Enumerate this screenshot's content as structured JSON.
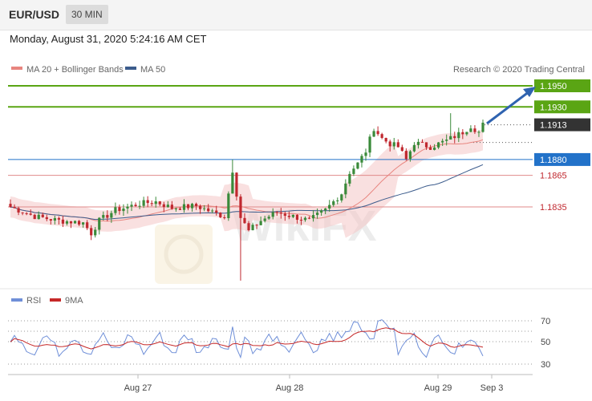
{
  "header": {
    "symbol": "EUR/USD",
    "timeframe": "30 MIN",
    "datetime": "Monday, August 31, 2020 5:24:16 AM CET"
  },
  "legend": {
    "ma20": "MA 20 + Bollinger Bands",
    "ma50": "MA 50",
    "credit": "Research © 2020 Trading Central"
  },
  "levels": [
    {
      "value": "1.1950",
      "color": "#5aa514",
      "style": "solid",
      "label_style": "box"
    },
    {
      "value": "1.1930",
      "color": "#5aa514",
      "style": "solid",
      "label_style": "box"
    },
    {
      "value": "1.1913",
      "color": "#333333",
      "style": "dotted",
      "label_style": "box"
    },
    {
      "value": "1.1880",
      "color": "#2272c9",
      "style": "solid",
      "label_style": "box"
    },
    {
      "value": "1.1865",
      "color": "#e08a8a",
      "style": "solid",
      "label_style": "text"
    },
    {
      "value": "1.1835",
      "color": "#e08a8a",
      "style": "solid",
      "label_style": "text"
    }
  ],
  "rsi_legend": {
    "rsi": "RSI",
    "ma9": "9MA"
  },
  "rsi_levels": [
    "70",
    "50",
    "30"
  ],
  "x_labels": [
    "Aug 27",
    "Aug 28",
    "Aug 29",
    "Sep 3"
  ],
  "watermark": "WikiFX",
  "colors": {
    "up": "#3a8a3a",
    "down": "#c0282f",
    "ma20": "#e8857f",
    "ma50": "#3c5c8c",
    "rsi": "#6f8fd8",
    "rsi_ma": "#c62828",
    "support": "#2272c9",
    "resistance": "#5aa514"
  },
  "chart_data": {
    "type": "candlestick",
    "x_labels": [
      "Aug 27",
      "Aug 28",
      "Aug 29",
      "Sep 3"
    ],
    "price_levels": [
      1.195,
      1.193,
      1.1913,
      1.188,
      1.1865,
      1.1835
    ],
    "current_price": 1.1913,
    "target": 1.195,
    "rsi_levels": [
      70,
      50,
      30
    ]
  }
}
